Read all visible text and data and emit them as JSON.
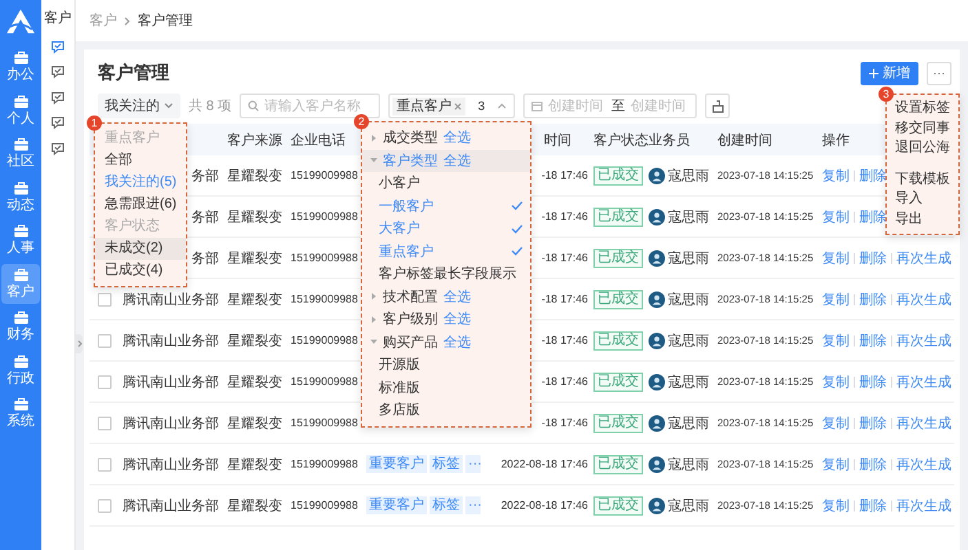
{
  "nav": {
    "items": [
      {
        "label": "办公",
        "selected": false
      },
      {
        "label": "个人",
        "selected": false
      },
      {
        "label": "社区",
        "selected": false
      },
      {
        "label": "动态",
        "selected": false
      },
      {
        "label": "人事",
        "selected": false
      },
      {
        "label": "客户",
        "selected": true
      },
      {
        "label": "财务",
        "selected": false
      },
      {
        "label": "行政",
        "selected": false
      },
      {
        "label": "系统",
        "selected": false
      }
    ]
  },
  "subnav": {
    "title": "客户",
    "items": [
      {
        "selected": true
      },
      {
        "selected": false
      },
      {
        "selected": false
      },
      {
        "selected": false
      },
      {
        "selected": false
      }
    ]
  },
  "breadcrumb": [
    "客户",
    "客户管理"
  ],
  "page": {
    "title": "客户管理",
    "add_button": "新增",
    "more_button": "···"
  },
  "filters": {
    "view": "我关注的",
    "count": "共 8 项",
    "search": {
      "placeholder": "请输入客户名称"
    },
    "tag_select": {
      "chips": [
        "重点客户"
      ],
      "more": "3"
    },
    "date_range": {
      "start_placeholder": "创建时间",
      "separator": "至",
      "end_placeholder": "创建时间"
    }
  },
  "table": {
    "columns": [
      "客户来源",
      "企业电话",
      "时间",
      "客户状态",
      "业务员",
      "创建时间",
      "操作"
    ],
    "rows": [
      {
        "name": "务部",
        "source": "星耀裂变",
        "phone": "15199009988",
        "time": "-18 17:46",
        "status": "已成交",
        "owner": "寇思雨",
        "created": "2023-07-18 14:15:25",
        "actions": [
          "复制",
          "删除"
        ]
      },
      {
        "name": "务部",
        "source": "星耀裂变",
        "phone": "15199009988",
        "time": "-18 17:46",
        "status": "已成交",
        "owner": "寇思雨",
        "created": "2023-07-18 14:15:25",
        "actions": [
          "复制",
          "删除"
        ]
      },
      {
        "name": "务部",
        "source": "星耀裂变",
        "phone": "15199009988",
        "time": "-18 17:46",
        "status": "已成交",
        "owner": "寇思雨",
        "created": "2023-07-18 14:15:25",
        "actions": [
          "复制",
          "删除",
          "再次生成"
        ]
      },
      {
        "checked": false,
        "name": "腾讯南山业务部",
        "source": "星耀裂变",
        "phone": "15199009988",
        "time": "-18 17:46",
        "status": "已成交",
        "owner": "寇思雨",
        "created": "2023-07-18 14:15:25",
        "actions": [
          "复制",
          "删除",
          "再次生成"
        ]
      },
      {
        "checked": false,
        "name": "腾讯南山业务部",
        "source": "星耀裂变",
        "phone": "15199009988",
        "time": "-18 17:46",
        "status": "已成交",
        "owner": "寇思雨",
        "created": "2023-07-18 14:15:25",
        "actions": [
          "复制",
          "删除",
          "再次生成"
        ]
      },
      {
        "checked": false,
        "name": "腾讯南山业务部",
        "source": "星耀裂变",
        "phone": "15199009988",
        "time": "-18 17:46",
        "status": "已成交",
        "owner": "寇思雨",
        "created": "2023-07-18 14:15:25",
        "actions": [
          "复制",
          "删除",
          "再次生成"
        ]
      },
      {
        "checked": false,
        "name": "腾讯南山业务部",
        "source": "星耀裂变",
        "phone": "15199009988",
        "time": "-18 17:46",
        "status": "已成交",
        "owner": "寇思雨",
        "created": "2023-07-18 14:15:25",
        "actions": [
          "复制",
          "删除",
          "再次生成"
        ]
      },
      {
        "checked": false,
        "name": "腾讯南山业务部",
        "source": "星耀裂变",
        "phone": "15199009988",
        "tags": [
          "重要客户",
          "标签",
          "···"
        ],
        "time": "2022-08-18 17:46",
        "status": "已成交",
        "owner": "寇思雨",
        "created": "2023-07-18 14:15:25",
        "actions": [
          "复制",
          "删除",
          "再次生成"
        ]
      },
      {
        "checked": false,
        "name": "腾讯南山业务部",
        "source": "星耀裂变",
        "phone": "15199009988",
        "tags": [
          "重要客户",
          "标签",
          "···"
        ],
        "time": "2022-08-18 17:46",
        "status": "已成交",
        "owner": "寇思雨",
        "created": "2023-07-18 14:15:25",
        "actions": [
          "复制",
          "删除",
          "再次生成"
        ]
      }
    ]
  },
  "view_menu": {
    "badge": "1",
    "items": [
      {
        "kind": "header",
        "label": "重点客户"
      },
      {
        "kind": "option",
        "label": "全部",
        "selected": false,
        "hovered": false
      },
      {
        "kind": "option",
        "label": "我关注的(5)",
        "selected": true,
        "hovered": false
      },
      {
        "kind": "option",
        "label": "急需跟进(6)",
        "selected": false,
        "hovered": false
      },
      {
        "kind": "header",
        "label": "客户状态"
      },
      {
        "kind": "option",
        "label": "未成交(2)",
        "selected": false,
        "hovered": true
      },
      {
        "kind": "option",
        "label": "已成交(4)",
        "selected": false,
        "hovered": false
      }
    ]
  },
  "tag_menu": {
    "badge": "2",
    "groups": [
      {
        "label": "成交类型",
        "select_all": "全选",
        "expanded": false,
        "hovered": false
      },
      {
        "label": "客户类型",
        "select_all": "全选",
        "expanded": true,
        "hovered": true,
        "children": [
          {
            "label": "小客户",
            "checked": false
          },
          {
            "label": "一般客户",
            "checked": true
          },
          {
            "label": "大客户",
            "checked": true
          },
          {
            "label": "重点客户",
            "checked": true
          },
          {
            "label": "客户标签最长字段展示",
            "checked": false
          }
        ]
      },
      {
        "label": "技术配置",
        "select_all": "全选",
        "expanded": false,
        "hovered": false
      },
      {
        "label": "客户级别",
        "select_all": "全选",
        "expanded": false,
        "hovered": false
      },
      {
        "label": "购买产品",
        "select_all": "全选",
        "expanded": true,
        "hovered": false,
        "children": [
          {
            "label": "开源版",
            "checked": false
          },
          {
            "label": "标准版",
            "checked": false
          },
          {
            "label": "多店版",
            "checked": false
          }
        ]
      }
    ]
  },
  "more_menu": {
    "badge": "3",
    "groups": [
      [
        "设置标签",
        "移交同事",
        "退回公海"
      ],
      [
        "下载模板",
        "导入",
        "导出"
      ]
    ]
  }
}
